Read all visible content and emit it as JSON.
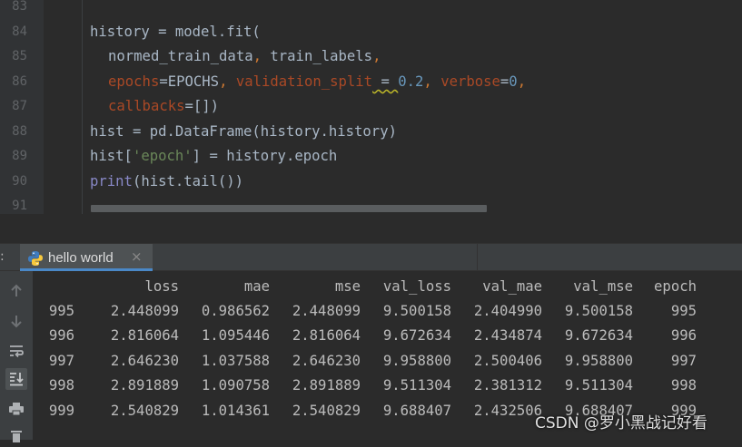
{
  "editor": {
    "line_numbers": [
      "83",
      "84",
      "85",
      "86",
      "87",
      "88",
      "89",
      "90",
      "91"
    ],
    "code": {
      "l84": {
        "a": "history = model.fit("
      },
      "l85": {
        "a": "normed_train_data",
        "b": ", ",
        "c": "train_labels",
        "d": ","
      },
      "l86": {
        "a": "epochs",
        "b": "=EPOCHS",
        "c": ", ",
        "d": "validation_split",
        "e": " = ",
        "f": "0.2",
        "g": ", ",
        "h": "verbose",
        "i": "=",
        "j": "0",
        "k": ","
      },
      "l87": {
        "a": "callbacks",
        "b": "=[])"
      },
      "l88": {
        "a": "hist = pd.DataFrame(history.history)"
      },
      "l89": {
        "a": "hist[",
        "b": "'epoch'",
        "c": "] = history.epoch"
      },
      "l90": {
        "a": "print",
        "b": "(hist.tail())"
      }
    }
  },
  "run_window": {
    "colon": ":",
    "tab": {
      "label": "hello world",
      "close": "×"
    },
    "toolbar_icons": [
      "up-arrow-icon",
      "down-arrow-icon",
      "soft-wrap-icon",
      "scroll-to-end-icon",
      "print-icon",
      "trash-icon"
    ]
  },
  "console_table": {
    "columns": [
      "",
      "loss",
      "mae",
      "mse",
      "val_loss",
      "val_mae",
      "val_mse",
      "epoch"
    ],
    "rows": [
      [
        "995",
        "2.448099",
        "0.986562",
        "2.448099",
        "9.500158",
        "2.404990",
        "9.500158",
        "995"
      ],
      [
        "996",
        "2.816064",
        "1.095446",
        "2.816064",
        "9.672634",
        "2.434874",
        "9.672634",
        "996"
      ],
      [
        "997",
        "2.646230",
        "1.037588",
        "2.646230",
        "9.958800",
        "2.500406",
        "9.958800",
        "997"
      ],
      [
        "998",
        "2.891889",
        "1.090758",
        "2.891889",
        "9.511304",
        "2.381312",
        "9.511304",
        "998"
      ],
      [
        "999",
        "2.540829",
        "1.014361",
        "2.540829",
        "9.688407",
        "2.432506",
        "9.688407",
        "999"
      ]
    ]
  },
  "watermark": "CSDN @罗小黑战记好看",
  "colors": {
    "keyword": "#cc7832",
    "param": "#aa4926",
    "number": "#6897bb",
    "string": "#6a8759",
    "builtin": "#8888c6",
    "text": "#a9b7c6",
    "accent": "#4a88c7"
  }
}
